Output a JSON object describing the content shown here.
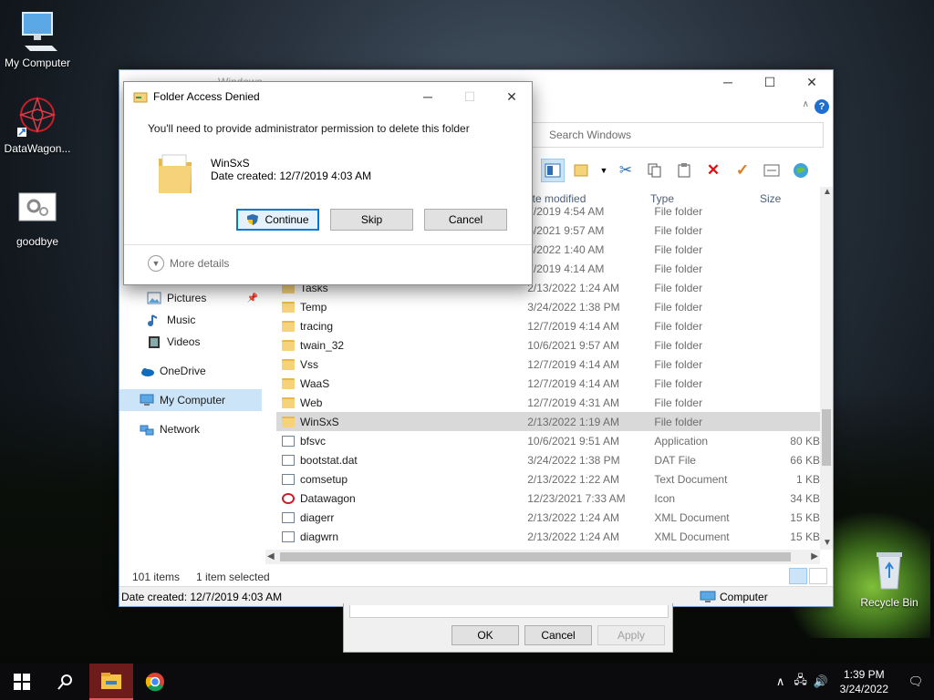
{
  "desktop": {
    "icons": [
      {
        "label": "My Computer"
      },
      {
        "label": "DataWagon..."
      },
      {
        "label": "goodbye"
      },
      {
        "label": "Recycle Bin"
      }
    ]
  },
  "explorer": {
    "title": "Windows",
    "search_placeholder": "Search Windows",
    "columns": {
      "date": "ate modified",
      "type": "Type",
      "size": "Size"
    },
    "nav": [
      {
        "label": "Pictures",
        "icon": "pictures-icon"
      },
      {
        "label": "Music",
        "icon": "music-icon"
      },
      {
        "label": "Videos",
        "icon": "videos-icon"
      },
      {
        "label": "OneDrive",
        "icon": "onedrive-icon"
      },
      {
        "label": "My Computer",
        "icon": "computer-icon"
      },
      {
        "label": "Network",
        "icon": "network-icon"
      }
    ],
    "rows": [
      {
        "name": "",
        "date": "7/2019 4:54 AM",
        "type": "File folder",
        "size": ""
      },
      {
        "name": "",
        "date": "6/2021 9:57 AM",
        "type": "File folder",
        "size": ""
      },
      {
        "name": "",
        "date": "3/2022 1:40 AM",
        "type": "File folder",
        "size": ""
      },
      {
        "name": "",
        "date": "7/2019 4:14 AM",
        "type": "File folder",
        "size": ""
      },
      {
        "name": "Tasks",
        "date": "2/13/2022 1:24 AM",
        "type": "File folder",
        "size": ""
      },
      {
        "name": "Temp",
        "date": "3/24/2022 1:38 PM",
        "type": "File folder",
        "size": ""
      },
      {
        "name": "tracing",
        "date": "12/7/2019 4:14 AM",
        "type": "File folder",
        "size": ""
      },
      {
        "name": "twain_32",
        "date": "10/6/2021 9:57 AM",
        "type": "File folder",
        "size": ""
      },
      {
        "name": "Vss",
        "date": "12/7/2019 4:14 AM",
        "type": "File folder",
        "size": ""
      },
      {
        "name": "WaaS",
        "date": "12/7/2019 4:14 AM",
        "type": "File folder",
        "size": ""
      },
      {
        "name": "Web",
        "date": "12/7/2019 4:31 AM",
        "type": "File folder",
        "size": ""
      },
      {
        "name": "WinSxS",
        "date": "2/13/2022 1:19 AM",
        "type": "File folder",
        "size": ""
      },
      {
        "name": "bfsvc",
        "date": "10/6/2021 9:51 AM",
        "type": "Application",
        "size": "80 KB"
      },
      {
        "name": "bootstat.dat",
        "date": "3/24/2022 1:38 PM",
        "type": "DAT File",
        "size": "66 KB"
      },
      {
        "name": "comsetup",
        "date": "2/13/2022 1:22 AM",
        "type": "Text Document",
        "size": "1 KB"
      },
      {
        "name": "Datawagon",
        "date": "12/23/2021 7:33 AM",
        "type": "Icon",
        "size": "34 KB"
      },
      {
        "name": "diagerr",
        "date": "2/13/2022 1:24 AM",
        "type": "XML Document",
        "size": "15 KB"
      },
      {
        "name": "diagwrn",
        "date": "2/13/2022 1:24 AM",
        "type": "XML Document",
        "size": "15 KB"
      }
    ],
    "status": {
      "items": "101 items",
      "selected": "1 item selected"
    },
    "details_bar": {
      "left": "Date created: 12/7/2019 4:03 AM",
      "right": "Computer"
    }
  },
  "properties": {
    "ok": "OK",
    "cancel": "Cancel",
    "apply": "Apply"
  },
  "dialog": {
    "title": "Folder Access Denied",
    "message": "You'll need to provide administrator permission to delete this folder",
    "folder_name": "WinSxS",
    "folder_date": "Date created: 12/7/2019 4:03 AM",
    "continue": "Continue",
    "skip": "Skip",
    "cancel": "Cancel",
    "more_details": "More details"
  },
  "taskbar": {
    "time": "1:39 PM",
    "date": "3/24/2022"
  },
  "colors": {
    "accent": "#0078d7",
    "selection": "#cce4f7",
    "folder": "#f6d37a"
  }
}
